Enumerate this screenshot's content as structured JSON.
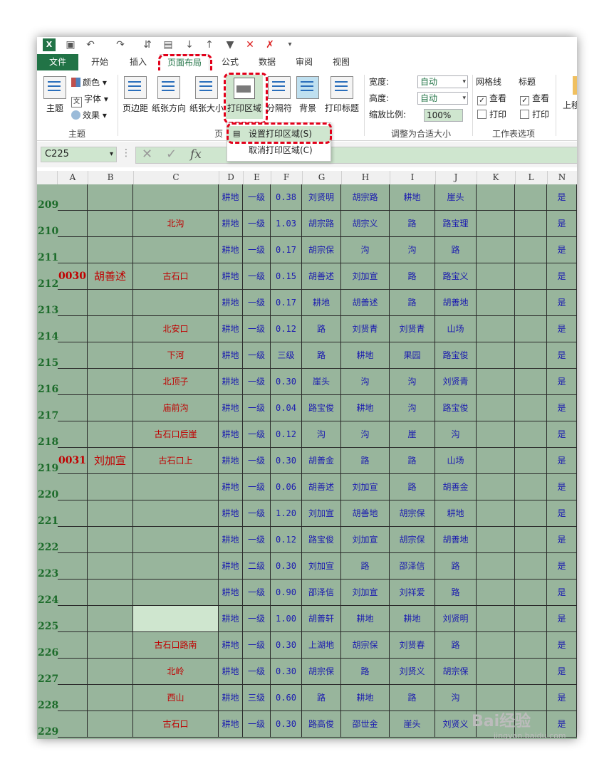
{
  "tabs": [
    "文件",
    "开始",
    "插入",
    "页面布局",
    "公式",
    "数据",
    "审阅",
    "视图"
  ],
  "ribbon": {
    "theme_group": {
      "label": "主题",
      "theme": "主题",
      "colors": "颜色",
      "fonts": "字体",
      "effects": "效果"
    },
    "page_setup_group": {
      "label": "页",
      "margins": "页边距",
      "orientation": "纸张方向",
      "size": "纸张大小",
      "print_area": "打印区域",
      "breaks": "分隔符",
      "background": "背景",
      "print_titles": "打印标题"
    },
    "scale_group": {
      "label": "调整为合适大小",
      "width_label": "宽度:",
      "width_value": "自动",
      "height_label": "高度:",
      "height_value": "自动",
      "scale_label": "缩放比例:",
      "scale_value": "100%"
    },
    "sheet_options_group": {
      "label": "工作表选项",
      "gridlines": "网格线",
      "headings": "标题",
      "view": "查看",
      "print": "打印",
      "gridlines_view_checked": true,
      "gridlines_print_checked": false,
      "headings_view_checked": true,
      "headings_print_checked": false
    },
    "arrange_partial": "上移"
  },
  "print_area_menu": {
    "set": "设置打印区域(S)",
    "clear": "取消打印区域(C)"
  },
  "name_box": "C225",
  "fx_label": "fx",
  "columns": [
    "A",
    "B",
    "C",
    "D",
    "E",
    "F",
    "G",
    "H",
    "I",
    "J",
    "K",
    "L",
    "N"
  ],
  "rows": [
    {
      "n": "209",
      "a": "",
      "b": "",
      "c": "",
      "d": "耕地",
      "e": "一级",
      "f": "0.38",
      "g": "刘贤明",
      "h": "胡宗路",
      "i": "耕地",
      "j": "崖头",
      "n2": "是"
    },
    {
      "n": "210",
      "a": "",
      "b": "",
      "c": "北沟",
      "d": "耕地",
      "e": "一级",
      "f": "1.03",
      "g": "胡宗路",
      "h": "胡宗义",
      "i": "路",
      "j": "路宝理",
      "n2": "是"
    },
    {
      "n": "211",
      "a": "",
      "b": "",
      "c": "",
      "d": "耕地",
      "e": "一级",
      "f": "0.17",
      "g": "胡宗保",
      "h": "沟",
      "i": "沟",
      "j": "路",
      "n2": "是"
    },
    {
      "n": "212",
      "a": "0030",
      "b": "胡善述",
      "c": "古石口",
      "d": "耕地",
      "e": "一级",
      "f": "0.15",
      "g": "胡善述",
      "h": "刘加宣",
      "i": "路",
      "j": "路宝义",
      "n2": "是"
    },
    {
      "n": "213",
      "a": "",
      "b": "",
      "c": "",
      "d": "耕地",
      "e": "一级",
      "f": "0.17",
      "g": "耕地",
      "h": "胡善述",
      "i": "路",
      "j": "胡善地",
      "n2": "是"
    },
    {
      "n": "214",
      "a": "",
      "b": "",
      "c": "北安口",
      "d": "耕地",
      "e": "一级",
      "f": "0.12",
      "g": "路",
      "h": "刘贤青",
      "i": "刘贤青",
      "j": "山场",
      "n2": "是"
    },
    {
      "n": "215",
      "a": "",
      "b": "",
      "c": "下河",
      "d": "耕地",
      "e": "一级",
      "f": "三级",
      "g": "路",
      "h": "耕地",
      "i": "果园",
      "j": "路宝俊",
      "n2": "是"
    },
    {
      "n": "216",
      "a": "",
      "b": "",
      "c": "北顶子",
      "d": "耕地",
      "e": "一级",
      "f": "0.30",
      "g": "崖头",
      "h": "沟",
      "i": "沟",
      "j": "刘贤青",
      "n2": "是"
    },
    {
      "n": "217",
      "a": "",
      "b": "",
      "c": "庙前沟",
      "d": "耕地",
      "e": "一级",
      "f": "0.04",
      "g": "路宝俊",
      "h": "耕地",
      "i": "沟",
      "j": "路宝俊",
      "n2": "是"
    },
    {
      "n": "218",
      "a": "",
      "b": "",
      "c": "古石口后崖",
      "d": "耕地",
      "e": "一级",
      "f": "0.12",
      "g": "沟",
      "h": "沟",
      "i": "崖",
      "j": "沟",
      "n2": "是"
    },
    {
      "n": "219",
      "a": "0031",
      "b": "刘加宣",
      "c": "古石口上",
      "d": "耕地",
      "e": "一级",
      "f": "0.30",
      "g": "胡善金",
      "h": "路",
      "i": "路",
      "j": "山场",
      "n2": "是"
    },
    {
      "n": "220",
      "a": "",
      "b": "",
      "c": "",
      "d": "耕地",
      "e": "一级",
      "f": "0.06",
      "g": "胡善述",
      "h": "刘加宣",
      "i": "路",
      "j": "胡善金",
      "n2": "是"
    },
    {
      "n": "221",
      "a": "",
      "b": "",
      "c": "",
      "d": "耕地",
      "e": "一级",
      "f": "1.20",
      "g": "刘加宣",
      "h": "胡善地",
      "i": "胡宗保",
      "j": "耕地",
      "n2": "是"
    },
    {
      "n": "222",
      "a": "",
      "b": "",
      "c": "",
      "d": "耕地",
      "e": "一级",
      "f": "0.12",
      "g": "路宝俊",
      "h": "刘加宣",
      "i": "胡宗保",
      "j": "胡善地",
      "n2": "是"
    },
    {
      "n": "223",
      "a": "",
      "b": "",
      "c": "",
      "d": "耕地",
      "e": "二级",
      "f": "0.30",
      "g": "刘加宣",
      "h": "路",
      "i": "邵泽信",
      "j": "路",
      "n2": "是"
    },
    {
      "n": "224",
      "a": "",
      "b": "",
      "c": "",
      "d": "耕地",
      "e": "一级",
      "f": "0.90",
      "g": "邵泽信",
      "h": "刘加宣",
      "i": "刘祥爱",
      "j": "路",
      "n2": "是"
    },
    {
      "n": "225",
      "a": "",
      "b": "",
      "c": "",
      "d": "耕地",
      "e": "一级",
      "f": "1.00",
      "g": "胡善轩",
      "h": "耕地",
      "i": "耕地",
      "j": "刘贤明",
      "n2": "是"
    },
    {
      "n": "226",
      "a": "",
      "b": "",
      "c": "古石口路南",
      "d": "耕地",
      "e": "一级",
      "f": "0.30",
      "g": "上湖地",
      "h": "胡宗保",
      "i": "刘贤春",
      "j": "路",
      "n2": "是"
    },
    {
      "n": "227",
      "a": "",
      "b": "",
      "c": "北岭",
      "d": "耕地",
      "e": "一级",
      "f": "0.30",
      "g": "胡宗保",
      "h": "路",
      "i": "刘贤义",
      "j": "胡宗保",
      "n2": "是"
    },
    {
      "n": "228",
      "a": "",
      "b": "",
      "c": "西山",
      "d": "耕地",
      "e": "三级",
      "f": "0.60",
      "g": "路",
      "h": "耕地",
      "i": "路",
      "j": "沟",
      "n2": "是"
    },
    {
      "n": "229",
      "a": "",
      "b": "",
      "c": "古石口",
      "d": "耕地",
      "e": "一级",
      "f": "0.30",
      "g": "路高俊",
      "h": "邵世金",
      "i": "崖头",
      "j": "刘贤义",
      "n2": "是"
    }
  ],
  "watermark": {
    "brand": "Bai经验",
    "url": "jingyan.baidu.com"
  }
}
